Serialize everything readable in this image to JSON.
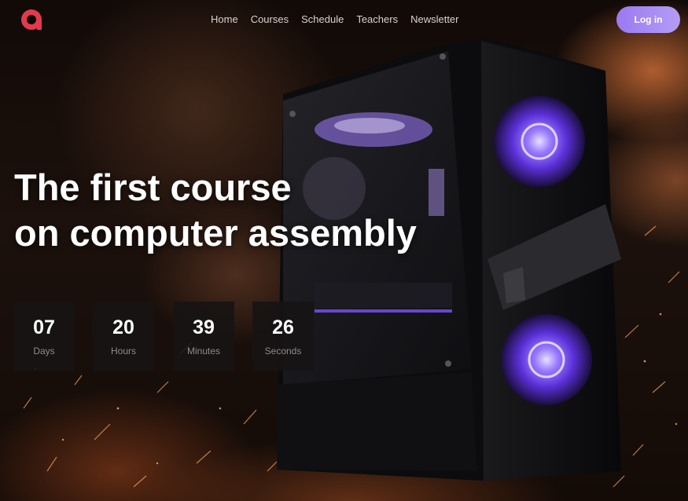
{
  "brand": {
    "logo_icon": "brand-logo-icon",
    "accent": "#e23a4c"
  },
  "nav": {
    "items": [
      {
        "label": "Home"
      },
      {
        "label": "Courses"
      },
      {
        "label": "Schedule"
      },
      {
        "label": "Teachers"
      },
      {
        "label": "Newsletter"
      }
    ]
  },
  "header": {
    "login_label": "Log in",
    "login_color": "#a98af4"
  },
  "hero": {
    "title_line1": "The first course",
    "title_line2": "on computer assembly",
    "image": {
      "subject": "gaming PC case with purple fans, sparks background",
      "fan_color": "#7a4dff"
    }
  },
  "countdown": {
    "items": [
      {
        "value": "07",
        "label": "Days"
      },
      {
        "value": "20",
        "label": "Hours"
      },
      {
        "value": "39",
        "label": "Minutes"
      },
      {
        "value": "26",
        "label": "Seconds"
      }
    ]
  }
}
